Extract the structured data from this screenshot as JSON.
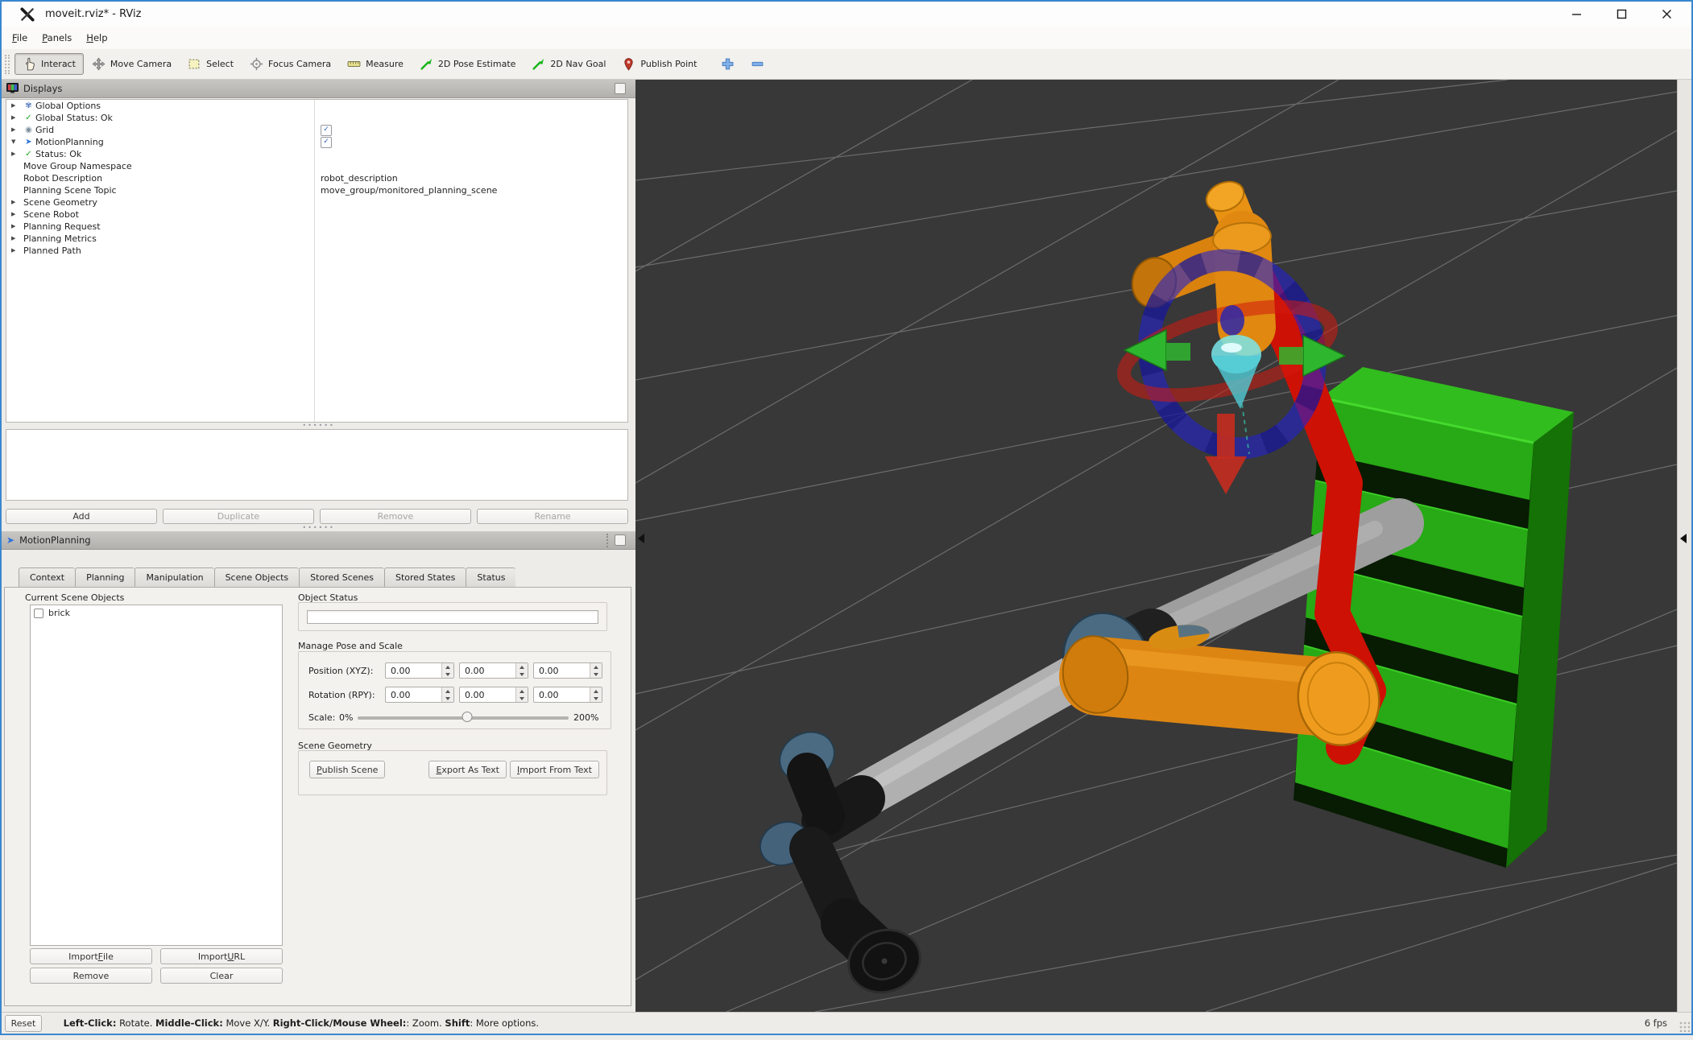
{
  "window": {
    "title": "moveit.rviz* - RViz"
  },
  "menu": {
    "items": [
      {
        "label": "&File"
      },
      {
        "label": "&Panels"
      },
      {
        "label": "&Help"
      }
    ]
  },
  "toolbar": {
    "tools": [
      {
        "label": "Interact",
        "icon": "hand-icon",
        "active": true
      },
      {
        "label": "Move Camera",
        "icon": "move-icon"
      },
      {
        "label": "Select",
        "icon": "select-box-icon"
      },
      {
        "label": "Focus Camera",
        "icon": "crosshair-icon"
      },
      {
        "label": "Measure",
        "icon": "ruler-icon"
      },
      {
        "label": "2D Pose Estimate",
        "icon": "green-arrow-icon"
      },
      {
        "label": "2D Nav Goal",
        "icon": "green-arrow-icon"
      },
      {
        "label": "Publish Point",
        "icon": "map-pin-icon"
      }
    ],
    "add_tool_icon": "plus-icon",
    "remove_tool_icon": "minus-icon"
  },
  "displays": {
    "title": "Displays",
    "tree": [
      {
        "label": "Global Options",
        "cls": "d0",
        "arrow": "arr-r",
        "icon": "ic-gear",
        "vtype": "vnone",
        "vtext": ""
      },
      {
        "label": "Global Status: Ok",
        "cls": "d0",
        "arrow": "arr-r",
        "icon": "ic-check",
        "vtype": "vnone",
        "vtext": ""
      },
      {
        "label": "Grid",
        "cls": "d0 hl",
        "arrow": "arr-r",
        "icon": "ic-eye",
        "vtype": "vcheck",
        "vtext": ""
      },
      {
        "label": "MotionPlanning",
        "cls": "d0 hl",
        "arrow": "arr-d",
        "icon": "ic-mp",
        "vtype": "vcheck",
        "vtext": ""
      },
      {
        "label": "Status: Ok",
        "cls": "d1",
        "arrow": "arr-r",
        "icon": "ic-check",
        "vtype": "vnone",
        "vtext": ""
      },
      {
        "label": "Move Group Namespace",
        "cls": "d1",
        "arrow": "arr-n",
        "icon": "ic-n",
        "vtype": "vnone",
        "vtext": ""
      },
      {
        "label": "Robot Description",
        "cls": "d1",
        "arrow": "arr-n",
        "icon": "ic-n",
        "vtype": "vtext",
        "vtext": "robot_description"
      },
      {
        "label": "Planning Scene Topic",
        "cls": "d1",
        "arrow": "arr-n",
        "icon": "ic-n",
        "vtype": "vtext",
        "vtext": "move_group/monitored_planning_scene"
      },
      {
        "label": "Scene Geometry",
        "cls": "d1",
        "arrow": "arr-r",
        "icon": "ic-n",
        "vtype": "vnone",
        "vtext": ""
      },
      {
        "label": "Scene Robot",
        "cls": "d1",
        "arrow": "arr-r",
        "icon": "ic-n",
        "vtype": "vnone",
        "vtext": ""
      },
      {
        "label": "Planning Request",
        "cls": "d1",
        "arrow": "arr-r",
        "icon": "ic-n",
        "vtype": "vnone",
        "vtext": ""
      },
      {
        "label": "Planning Metrics",
        "cls": "d1",
        "arrow": "arr-r",
        "icon": "ic-n",
        "vtype": "vnone",
        "vtext": ""
      },
      {
        "label": "Planned Path",
        "cls": "d1",
        "arrow": "arr-r",
        "icon": "ic-n",
        "vtype": "vnone",
        "vtext": ""
      }
    ],
    "buttons": {
      "add": "Add",
      "duplicate": "Duplicate",
      "remove": "Remove",
      "rename": "Rename"
    }
  },
  "motion_planning": {
    "title": "MotionPlanning",
    "tabs": [
      {
        "label": "Context",
        "cls": "t"
      },
      {
        "label": "Planning",
        "cls": "t"
      },
      {
        "label": "Manipulation",
        "cls": "t"
      },
      {
        "label": "Scene Objects",
        "cls": "active"
      },
      {
        "label": "Stored Scenes",
        "cls": "t"
      },
      {
        "label": "Stored States",
        "cls": "t"
      },
      {
        "label": "Status",
        "cls": "t"
      }
    ],
    "scene_objects": {
      "current_label": "Current Scene Objects",
      "objects": [
        {
          "label": "brick",
          "checked": false
        }
      ],
      "import_file": "Import &File",
      "import_url": "Import &URL",
      "remove": "Remove",
      "clear": "Clear",
      "object_status_label": "Object Status",
      "object_status_value": "",
      "manage_label": "Manage Pose and Scale",
      "position_label": "Position (XYZ):",
      "position": [
        "0.00",
        "0.00",
        "0.00"
      ],
      "rotation_label": "Rotation (RPY):",
      "rotation": [
        "0.00",
        "0.00",
        "0.00"
      ],
      "scale_label": "Scale:",
      "scale_min": "0%",
      "scale_max": "200%",
      "slider_position_percent": 52,
      "scene_geometry_label": "Scene Geometry",
      "publish_scene": "&Publish Scene",
      "export_as_text": "&Export As Text",
      "import_from_text": "&Import From Text"
    }
  },
  "status_bar": {
    "reset": "Reset",
    "help": [
      {
        "b": "Left-Click:",
        "t": " Rotate. "
      },
      {
        "b": "Middle-Click:",
        "t": " Move X/Y. "
      },
      {
        "b": "Right-Click/Mouse Wheel:",
        "t": ": Zoom. "
      },
      {
        "b": "Shift",
        "t": ": More options."
      }
    ],
    "fps": "6 fps"
  },
  "viewport": {
    "background": "#383838",
    "grid_color": "#909090",
    "colors": {
      "current_robot_gray": "#b0b0b0",
      "joint_cap_slate": "#4b6b82",
      "goal_robot_orange": "#e08810",
      "collision_link_red": "#ce1105",
      "scene_object_green": "#27aa15",
      "marker_ring_blue": "#2222cf",
      "marker_ring_red": "#d2190f",
      "marker_arrow_green": "#2fb62f",
      "end_effector_cyan": "#7ae6ea"
    },
    "objects": [
      "current-state-robot-gray",
      "goal-state-robot-orange",
      "collision-links-red",
      "interactive-marker-rings-and-arrows",
      "scene-object-brick-green-shelf",
      "ground-grid"
    ]
  }
}
